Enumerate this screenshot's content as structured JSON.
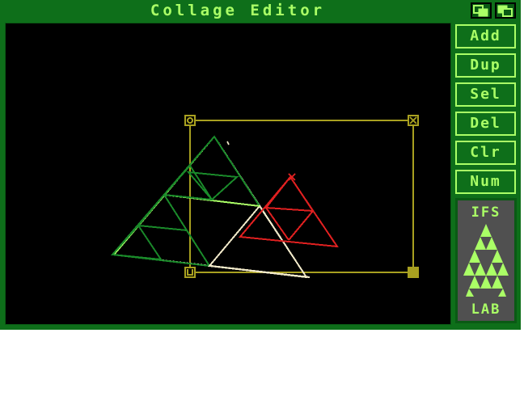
{
  "window": {
    "title": "Collage Editor"
  },
  "toolbar": {
    "buttons": [
      {
        "id": "add",
        "label": "Add"
      },
      {
        "id": "dup",
        "label": "Dup"
      },
      {
        "id": "sel",
        "label": "Sel"
      },
      {
        "id": "del",
        "label": "Del"
      },
      {
        "id": "clr",
        "label": "Clr"
      },
      {
        "id": "num",
        "label": "Num"
      }
    ]
  },
  "logo": {
    "line1": "IFS",
    "line2": "LAB",
    "icon": "sierpinski-triangle-icon"
  },
  "colors": {
    "window_bg": "#0e6f1a",
    "text_accent": "#aaff66",
    "canvas_bg": "#000000",
    "selection_box": "#a8a020",
    "transform_green": "#1a8a2a",
    "transform_light_green": "#aaff66",
    "transform_cream": "#f0e8c8",
    "transform_red": "#e02020",
    "logo_bg": "#505050"
  }
}
